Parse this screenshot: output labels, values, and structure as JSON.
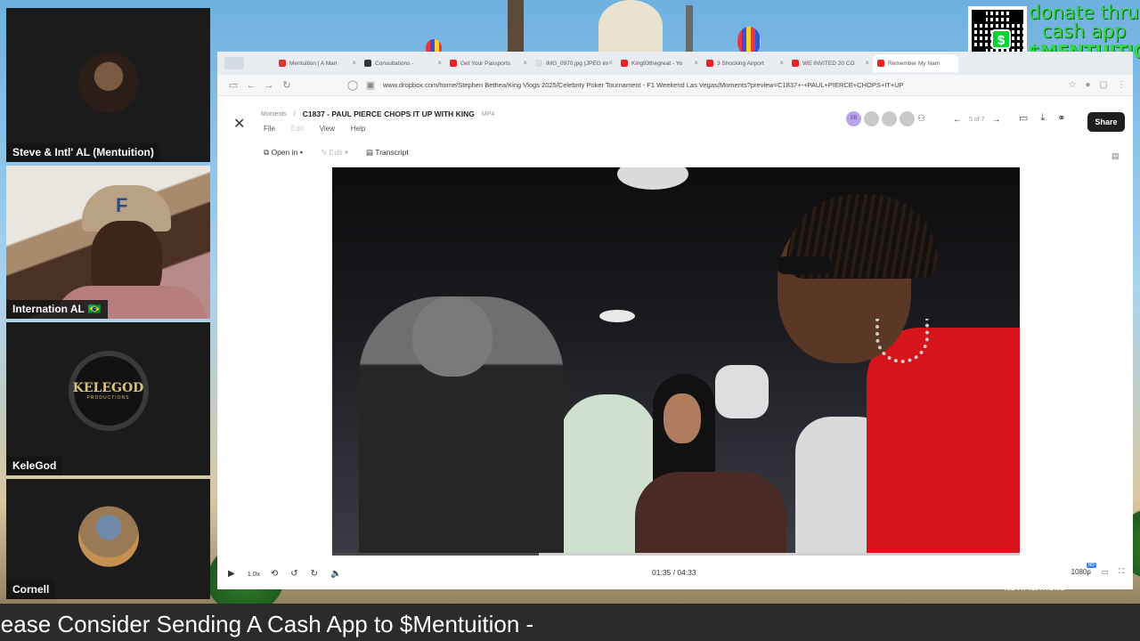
{
  "stream": {
    "donate": {
      "line1": "donate thru",
      "line2": "cash app",
      "line3": "$MENTUITION",
      "qr_glyph": "$"
    },
    "participants": [
      {
        "name": "Steve & Intl' AL (Mentuition)",
        "flag": ""
      },
      {
        "name": "Internation AL",
        "flag": "🇧🇷"
      },
      {
        "name": "KeleGod",
        "flag": "",
        "logo_main": "KELEGOD",
        "logo_sub": "PRODUCTIONS"
      },
      {
        "name": "Cornell",
        "flag": ""
      }
    ],
    "ticker": "lease Consider Sending A Cash App to $Mentuition -",
    "notifications_label": "NOTIFICATIONS"
  },
  "browser": {
    "tabs": [
      {
        "label": "Mentuition | A Man"
      },
      {
        "label": "Consultations -"
      },
      {
        "label": "Get Your Passports"
      },
      {
        "label": "IMG_0970.jpg (JPEG im"
      },
      {
        "label": "King93thegreat - Yo"
      },
      {
        "label": "3 Shocking Airport"
      },
      {
        "label": "WE INVITED 20 CO"
      },
      {
        "label": "Remember My Nam"
      }
    ],
    "url": "www.dropbox.com/home/Stephen Bethea/King Vlogs 2025/Celebrity Poker Tournament - F1 Weekend Las Vegas/Moments?preview=C1837+-+PAUL+PIERCE+CHOPS+IT+UP"
  },
  "dropbox": {
    "breadcrumb_root": "Moments",
    "file_title": "C1837 - PAUL PIERCE CHOPS IT UP WITH KING",
    "file_ext": "MP4",
    "menu": [
      "File",
      "Edit",
      "View",
      "Help"
    ],
    "open_in": "Open in",
    "edit": "Edit",
    "transcript": "Transcript",
    "avatar_initials": "SB",
    "pager": "5 of 7",
    "share": "Share"
  },
  "player": {
    "speed": "1.0x",
    "current_time": "01:35",
    "duration": "04:33",
    "time_display": "01:35 / 04:33",
    "quality": "1080p",
    "quality_badge": "HD",
    "progress": 0.3
  }
}
